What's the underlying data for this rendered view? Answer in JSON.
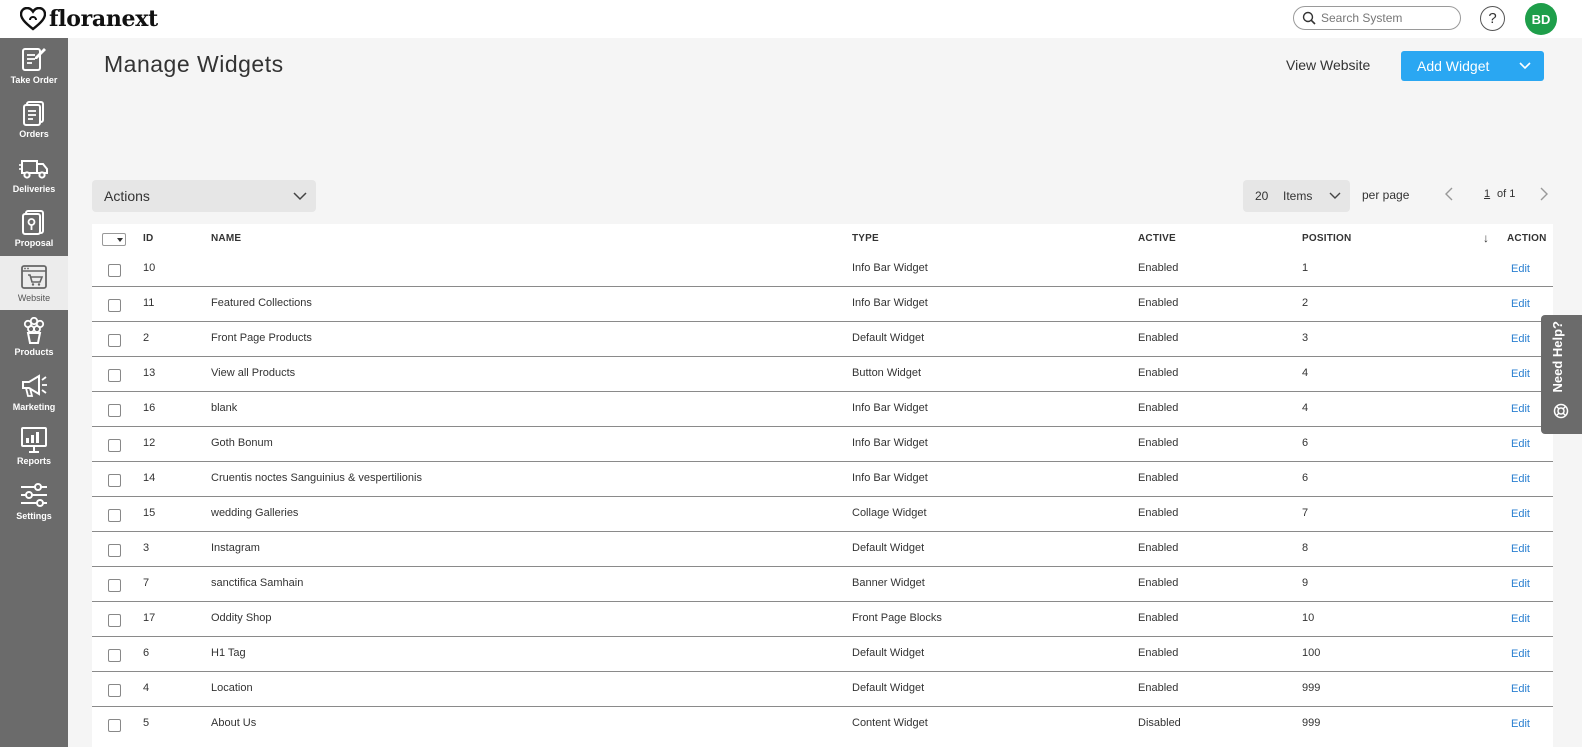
{
  "app": {
    "logo_text": "floranext"
  },
  "header": {
    "search_placeholder": "Search System",
    "help_label": "?",
    "user_initials": "BD",
    "avatar_color": "#1e9e4a"
  },
  "sidebar": {
    "items": [
      {
        "label": "Take Order",
        "icon": "take-order-icon"
      },
      {
        "label": "Orders",
        "icon": "orders-icon"
      },
      {
        "label": "Deliveries",
        "icon": "delivery-truck-icon"
      },
      {
        "label": "Proposal",
        "icon": "proposal-icon"
      },
      {
        "label": "Website",
        "icon": "website-cart-icon",
        "active": true
      },
      {
        "label": "Products",
        "icon": "flowers-icon"
      },
      {
        "label": "Marketing",
        "icon": "megaphone-icon"
      },
      {
        "label": "Reports",
        "icon": "reports-chart-icon"
      },
      {
        "label": "Settings",
        "icon": "sliders-icon"
      }
    ]
  },
  "page": {
    "title": "Manage Widgets",
    "view_website_label": "View Website",
    "add_widget_label": "Add Widget",
    "accent_color": "#2aa7f2"
  },
  "toolbar": {
    "actions_label": "Actions",
    "per_page_value": "20",
    "per_page_unit": "Items",
    "per_page_label": "per page",
    "current_page": "1",
    "page_of": "of 1"
  },
  "table": {
    "columns": {
      "id": "ID",
      "name": "NAME",
      "type": "TYPE",
      "active": "ACTIVE",
      "position": "POSITION",
      "action": "ACTION"
    },
    "edit_label": "Edit",
    "rows": [
      {
        "id": "10",
        "name": "",
        "type": "Info Bar Widget",
        "active": "Enabled",
        "position": "1"
      },
      {
        "id": "11",
        "name": "Featured Collections",
        "type": "Info Bar Widget",
        "active": "Enabled",
        "position": "2"
      },
      {
        "id": "2",
        "name": "Front Page Products",
        "type": "Default Widget",
        "active": "Enabled",
        "position": "3"
      },
      {
        "id": "13",
        "name": "View all Products",
        "type": "Button Widget",
        "active": "Enabled",
        "position": "4"
      },
      {
        "id": "16",
        "name": "blank",
        "type": "Info Bar Widget",
        "active": "Enabled",
        "position": "4"
      },
      {
        "id": "12",
        "name": "Goth Bonum",
        "type": "Info Bar Widget",
        "active": "Enabled",
        "position": "6"
      },
      {
        "id": "14",
        "name": "Cruentis noctes Sanguinius & vespertilionis",
        "type": "Info Bar Widget",
        "active": "Enabled",
        "position": "6"
      },
      {
        "id": "15",
        "name": "wedding Galleries",
        "type": "Collage Widget",
        "active": "Enabled",
        "position": "7"
      },
      {
        "id": "3",
        "name": "Instagram",
        "type": "Default Widget",
        "active": "Enabled",
        "position": "8"
      },
      {
        "id": "7",
        "name": "sanctifica Samhain",
        "type": "Banner Widget",
        "active": "Enabled",
        "position": "9"
      },
      {
        "id": "17",
        "name": "Oddity Shop",
        "type": "Front Page Blocks",
        "active": "Enabled",
        "position": "10"
      },
      {
        "id": "6",
        "name": "H1 Tag",
        "type": "Default Widget",
        "active": "Enabled",
        "position": "100"
      },
      {
        "id": "4",
        "name": "Location",
        "type": "Default Widget",
        "active": "Enabled",
        "position": "999"
      },
      {
        "id": "5",
        "name": "About Us",
        "type": "Content Widget",
        "active": "Disabled",
        "position": "999"
      }
    ]
  },
  "need_help": {
    "label": "Need Help?"
  }
}
